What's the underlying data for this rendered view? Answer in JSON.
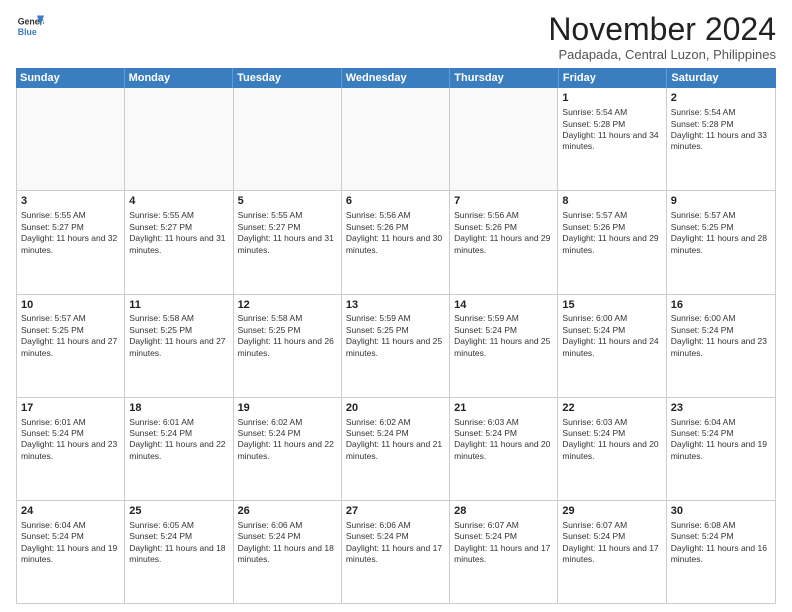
{
  "logo": {
    "line1": "General",
    "line2": "Blue"
  },
  "title": "November 2024",
  "location": "Padapada, Central Luzon, Philippines",
  "days_of_week": [
    "Sunday",
    "Monday",
    "Tuesday",
    "Wednesday",
    "Thursday",
    "Friday",
    "Saturday"
  ],
  "weeks": [
    [
      {
        "day": "",
        "empty": true,
        "info": ""
      },
      {
        "day": "",
        "empty": true,
        "info": ""
      },
      {
        "day": "",
        "empty": true,
        "info": ""
      },
      {
        "day": "",
        "empty": true,
        "info": ""
      },
      {
        "day": "",
        "empty": true,
        "info": ""
      },
      {
        "day": "1",
        "empty": false,
        "info": "Sunrise: 5:54 AM\nSunset: 5:28 PM\nDaylight: 11 hours and 34 minutes."
      },
      {
        "day": "2",
        "empty": false,
        "info": "Sunrise: 5:54 AM\nSunset: 5:28 PM\nDaylight: 11 hours and 33 minutes."
      }
    ],
    [
      {
        "day": "3",
        "empty": false,
        "info": "Sunrise: 5:55 AM\nSunset: 5:27 PM\nDaylight: 11 hours and 32 minutes."
      },
      {
        "day": "4",
        "empty": false,
        "info": "Sunrise: 5:55 AM\nSunset: 5:27 PM\nDaylight: 11 hours and 31 minutes."
      },
      {
        "day": "5",
        "empty": false,
        "info": "Sunrise: 5:55 AM\nSunset: 5:27 PM\nDaylight: 11 hours and 31 minutes."
      },
      {
        "day": "6",
        "empty": false,
        "info": "Sunrise: 5:56 AM\nSunset: 5:26 PM\nDaylight: 11 hours and 30 minutes."
      },
      {
        "day": "7",
        "empty": false,
        "info": "Sunrise: 5:56 AM\nSunset: 5:26 PM\nDaylight: 11 hours and 29 minutes."
      },
      {
        "day": "8",
        "empty": false,
        "info": "Sunrise: 5:57 AM\nSunset: 5:26 PM\nDaylight: 11 hours and 29 minutes."
      },
      {
        "day": "9",
        "empty": false,
        "info": "Sunrise: 5:57 AM\nSunset: 5:25 PM\nDaylight: 11 hours and 28 minutes."
      }
    ],
    [
      {
        "day": "10",
        "empty": false,
        "info": "Sunrise: 5:57 AM\nSunset: 5:25 PM\nDaylight: 11 hours and 27 minutes."
      },
      {
        "day": "11",
        "empty": false,
        "info": "Sunrise: 5:58 AM\nSunset: 5:25 PM\nDaylight: 11 hours and 27 minutes."
      },
      {
        "day": "12",
        "empty": false,
        "info": "Sunrise: 5:58 AM\nSunset: 5:25 PM\nDaylight: 11 hours and 26 minutes."
      },
      {
        "day": "13",
        "empty": false,
        "info": "Sunrise: 5:59 AM\nSunset: 5:25 PM\nDaylight: 11 hours and 25 minutes."
      },
      {
        "day": "14",
        "empty": false,
        "info": "Sunrise: 5:59 AM\nSunset: 5:24 PM\nDaylight: 11 hours and 25 minutes."
      },
      {
        "day": "15",
        "empty": false,
        "info": "Sunrise: 6:00 AM\nSunset: 5:24 PM\nDaylight: 11 hours and 24 minutes."
      },
      {
        "day": "16",
        "empty": false,
        "info": "Sunrise: 6:00 AM\nSunset: 5:24 PM\nDaylight: 11 hours and 23 minutes."
      }
    ],
    [
      {
        "day": "17",
        "empty": false,
        "info": "Sunrise: 6:01 AM\nSunset: 5:24 PM\nDaylight: 11 hours and 23 minutes."
      },
      {
        "day": "18",
        "empty": false,
        "info": "Sunrise: 6:01 AM\nSunset: 5:24 PM\nDaylight: 11 hours and 22 minutes."
      },
      {
        "day": "19",
        "empty": false,
        "info": "Sunrise: 6:02 AM\nSunset: 5:24 PM\nDaylight: 11 hours and 22 minutes."
      },
      {
        "day": "20",
        "empty": false,
        "info": "Sunrise: 6:02 AM\nSunset: 5:24 PM\nDaylight: 11 hours and 21 minutes."
      },
      {
        "day": "21",
        "empty": false,
        "info": "Sunrise: 6:03 AM\nSunset: 5:24 PM\nDaylight: 11 hours and 20 minutes."
      },
      {
        "day": "22",
        "empty": false,
        "info": "Sunrise: 6:03 AM\nSunset: 5:24 PM\nDaylight: 11 hours and 20 minutes."
      },
      {
        "day": "23",
        "empty": false,
        "info": "Sunrise: 6:04 AM\nSunset: 5:24 PM\nDaylight: 11 hours and 19 minutes."
      }
    ],
    [
      {
        "day": "24",
        "empty": false,
        "info": "Sunrise: 6:04 AM\nSunset: 5:24 PM\nDaylight: 11 hours and 19 minutes."
      },
      {
        "day": "25",
        "empty": false,
        "info": "Sunrise: 6:05 AM\nSunset: 5:24 PM\nDaylight: 11 hours and 18 minutes."
      },
      {
        "day": "26",
        "empty": false,
        "info": "Sunrise: 6:06 AM\nSunset: 5:24 PM\nDaylight: 11 hours and 18 minutes."
      },
      {
        "day": "27",
        "empty": false,
        "info": "Sunrise: 6:06 AM\nSunset: 5:24 PM\nDaylight: 11 hours and 17 minutes."
      },
      {
        "day": "28",
        "empty": false,
        "info": "Sunrise: 6:07 AM\nSunset: 5:24 PM\nDaylight: 11 hours and 17 minutes."
      },
      {
        "day": "29",
        "empty": false,
        "info": "Sunrise: 6:07 AM\nSunset: 5:24 PM\nDaylight: 11 hours and 17 minutes."
      },
      {
        "day": "30",
        "empty": false,
        "info": "Sunrise: 6:08 AM\nSunset: 5:24 PM\nDaylight: 11 hours and 16 minutes."
      }
    ]
  ]
}
